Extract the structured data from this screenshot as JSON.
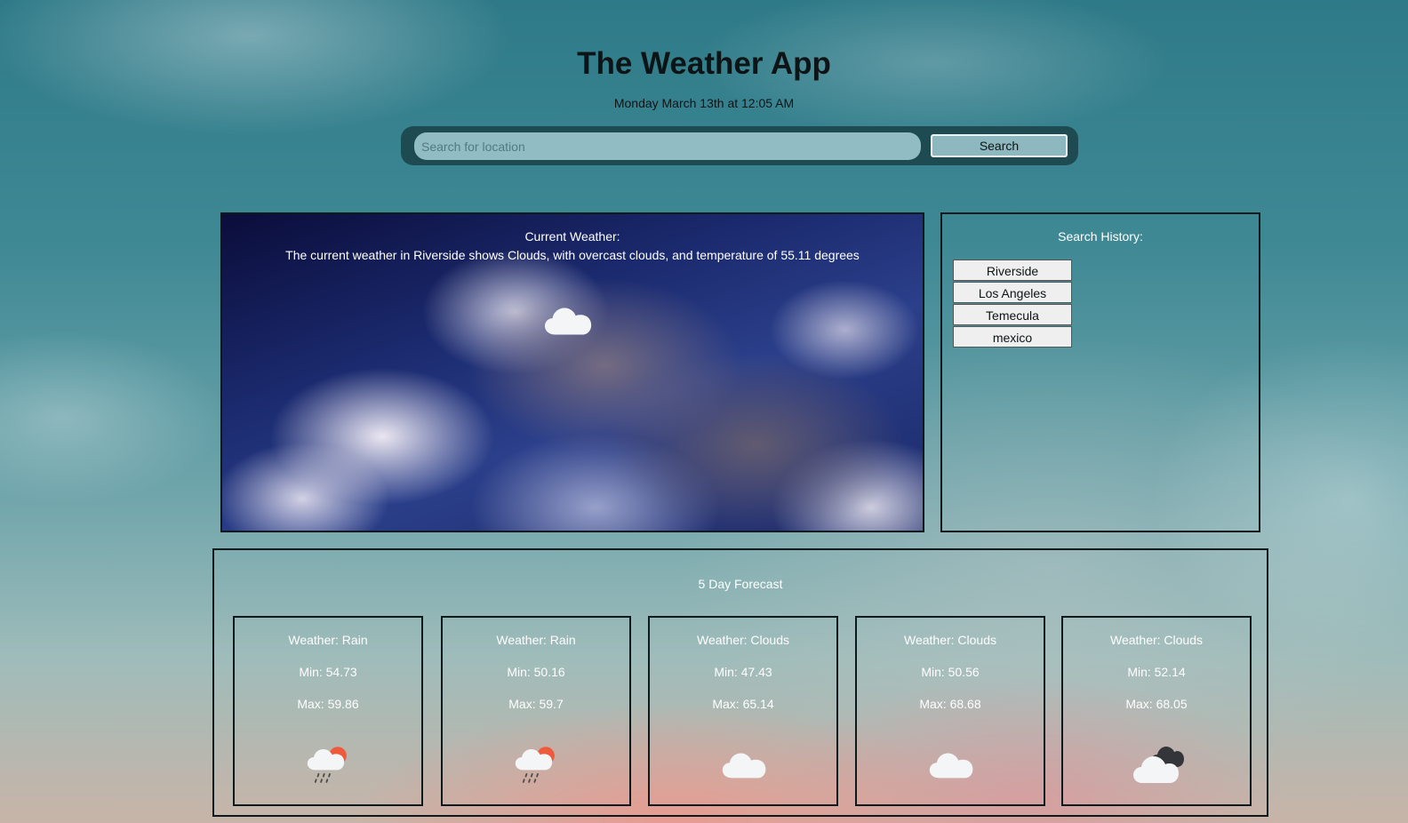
{
  "app": {
    "title": "The Weather App",
    "date": "Monday March 13th at 12:05 AM"
  },
  "search": {
    "placeholder": "Search for location",
    "value": "",
    "button_label": "Search"
  },
  "current_weather": {
    "heading": "Current Weather:",
    "description": "The current weather in Riverside shows Clouds, with overcast clouds, and temperature of 55.11 degrees",
    "icon": "cloud-icon"
  },
  "search_history": {
    "heading": "Search History:",
    "items": [
      "Riverside",
      "Los Angeles",
      "Temecula",
      "mexico"
    ]
  },
  "forecast": {
    "heading": "5 Day Forecast",
    "days": [
      {
        "weather": "Weather: Rain",
        "min": "Min: 54.73",
        "max": "Max: 59.86",
        "icon": "rain-sun-icon"
      },
      {
        "weather": "Weather: Rain",
        "min": "Min: 50.16",
        "max": "Max: 59.7",
        "icon": "rain-sun-icon"
      },
      {
        "weather": "Weather: Clouds",
        "min": "Min: 47.43",
        "max": "Max: 65.14",
        "icon": "cloud-icon"
      },
      {
        "weather": "Weather: Clouds",
        "min": "Min: 50.56",
        "max": "Max: 68.68",
        "icon": "cloud-icon"
      },
      {
        "weather": "Weather: Clouds",
        "min": "Min: 52.14",
        "max": "Max: 68.05",
        "icon": "broken-clouds-icon"
      }
    ]
  },
  "colors": {
    "search_bar_bg": "#1e4a52",
    "search_input_bg": "#92bcc3",
    "panel_border": "#0c1a1d",
    "panel_text": "#ffffff",
    "history_button_bg": "#efefef"
  }
}
